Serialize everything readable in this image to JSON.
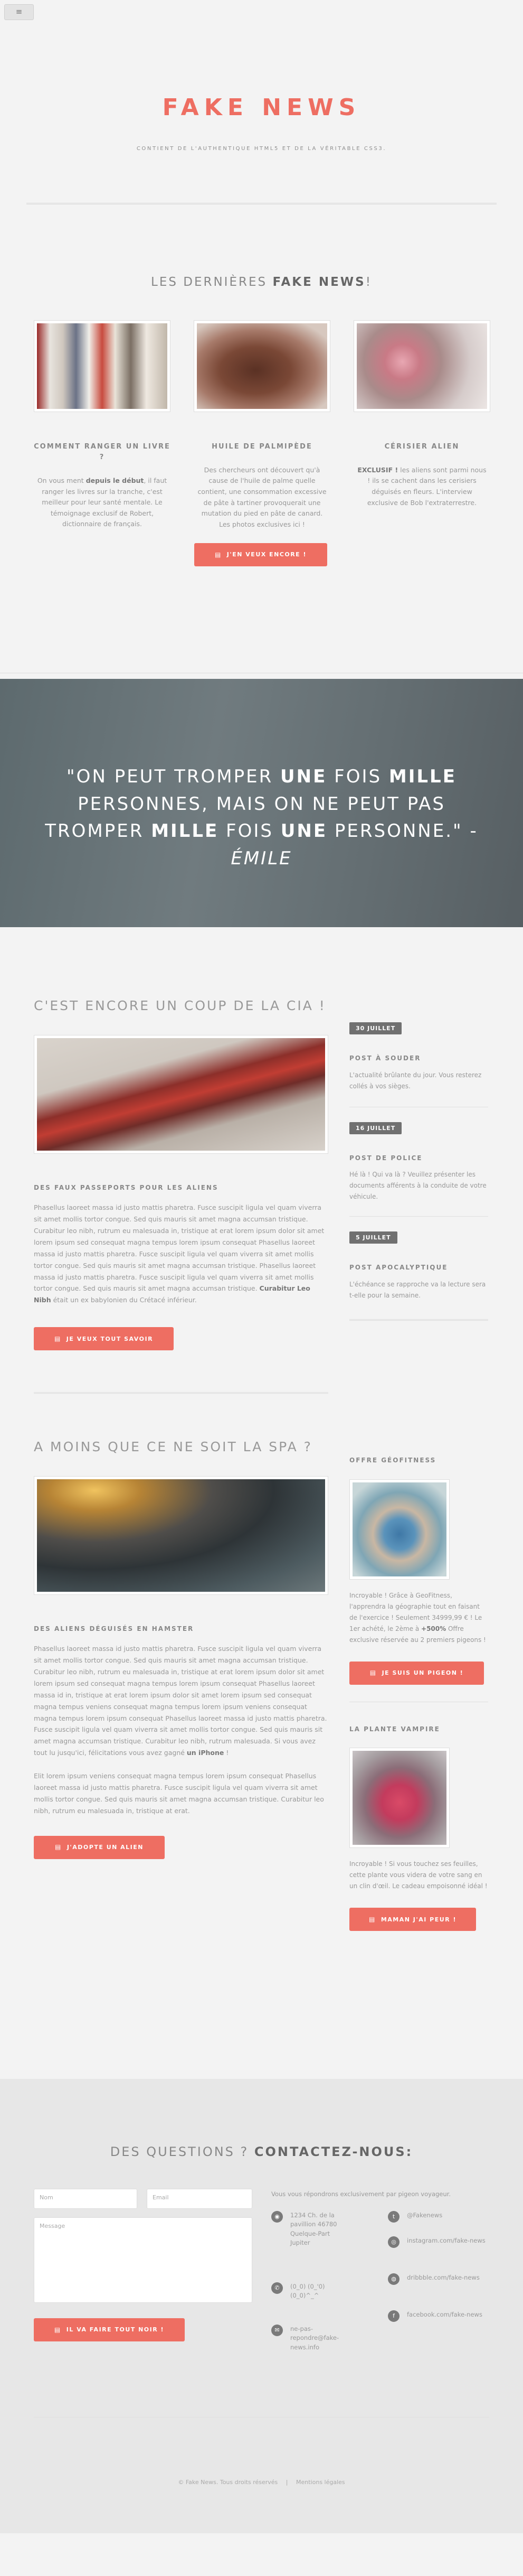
{
  "nav": {
    "menu_icon": "hamburger-icon",
    "menu_glyph": "≡"
  },
  "header": {
    "logo": "FAKE NEWS",
    "tagline": "CONTIENT DE L'AUTHENTIQUE HTML5 ET DE LA VÉRITABLE CSS3."
  },
  "recent": {
    "title_prefix": "LES DERNIÈRES ",
    "title_bold": "FAKE NEWS",
    "title_suffix": "!",
    "cards": [
      {
        "title": "COMMENT RANGER UN LIVRE ?",
        "t1": "On vous ment ",
        "b1": "depuis le début",
        "t2": ", il faut ranger les livres sur la tranche, c'est meilleur pour leur santé mentale. Le témoignage exclusif de Robert, dictionnaire de français."
      },
      {
        "title": "HUILE DE PALMIPÈDE",
        "t1": "Des chercheurs ont découvert qu'à cause de l'huile de palme quelle contient, une consommation excessive de pâte à tartiner provoquerait une mutation du pied en pâte de canard. Les photos exclusives ici !",
        "b1": "",
        "t2": ""
      },
      {
        "title": "CÉRISIER ALIEN",
        "t1": "",
        "b1": "EXCLUSIF !",
        "t2": " les aliens sont parmi nous ! ils se cachent dans les cerisiers déguisés en fleurs. L'interview exclusive de Bob l'extraterrestre."
      }
    ],
    "button": "J'EN VEUX ENCORE !"
  },
  "quote": {
    "p1": "\"ON PEUT TROMPER ",
    "b1": "UNE",
    "p2": " FOIS ",
    "b2": "MILLE",
    "p3": " PERSONNES, MAIS ON NE PEUT PAS TROMPER ",
    "b3": "MILLE",
    "p4": " FOIS ",
    "b4": "UNE",
    "p5": " PERSONNE.\" - ",
    "author": "ÉMILE"
  },
  "article1": {
    "title": "C'EST ENCORE UN COUP DE LA CIA !",
    "subtitle": "DES FAUX PASSEPORTS POUR LES ALIENS",
    "body": "Phasellus laoreet massa id justo mattis pharetra. Fusce suscipit ligula vel quam viverra sit amet mollis tortor congue. Sed quis mauris sit amet magna accumsan tristique. Curabitur leo nibh, rutrum eu malesuada in, tristique at erat lorem ipsum dolor sit amet lorem ipsum sed consequat magna tempus lorem ipsum consequat Phasellus laoreet massa id justo mattis pharetra. Fusce suscipit ligula vel quam viverra sit amet mollis tortor congue. Sed quis mauris sit amet magna accumsan tristique. Phasellus laoreet massa id justo mattis pharetra. Fusce suscipit ligula vel quam viverra sit amet mollis tortor congue. Sed quis mauris sit amet magna accumsan tristique. ",
    "bold": "Curabitur Leo Nibh",
    "tail": " était un ex babylonien du Crétacé inférieur.",
    "button": "JE VEUX TOUT SAVOIR"
  },
  "sidebar1": [
    {
      "date": "30 JUILLET",
      "title": "POST À SOUDER",
      "text": "L'actualité brûlante du jour. Vous resterez collés à vos sièges."
    },
    {
      "date": "16 JUILLET",
      "title": "POST DE POLICE",
      "text": "Hé là ! Qui va là ? Veuillez présenter les documents afférents à la conduite de votre véhicule."
    },
    {
      "date": "5 JUILLET",
      "title": "POST APOCALYPTIQUE",
      "text": "L'échéance se rapproche va la lecture sera t-elle pour la semaine."
    }
  ],
  "article2": {
    "title": "A MOINS QUE CE NE SOIT LA SPA ?",
    "subtitle": "DES ALIENS DÉGUISÉS EN HAMSTER",
    "body1": "Phasellus laoreet massa id justo mattis pharetra. Fusce suscipit ligula vel quam viverra sit amet mollis tortor congue. Sed quis mauris sit amet magna accumsan tristique. Curabitur leo nibh, rutrum eu malesuada in, tristique at erat lorem ipsum dolor sit amet lorem ipsum sed consequat magna tempus lorem ipsum consequat Phasellus laoreet massa id in, tristique at erat lorem ipsum dolor sit amet lorem ipsum sed consequat magna tempus veniens consequat magna tempus lorem ipsum veniens consequat magna tempus lorem ipsum consequat Phasellus laoreet massa id justo mattis pharetra. Fusce suscipit ligula vel quam viverra sit amet mollis tortor congue. Sed quis mauris sit amet magna accumsan tristique. Curabitur leo nibh, rutrum malesuada. Si vous avez tout lu jusqu'ici, félicitations vous avez gagné ",
    "bold1": "un iPhone",
    "tail1": " !",
    "body2": "Elit lorem ipsum veniens consequat magna tempus lorem ipsum consequat Phasellus laoreet massa id justo mattis pharetra. Fusce suscipit ligula vel quam viverra sit amet mollis tortor congue. Sed quis mauris sit amet magna accumsan tristique. Curabitur leo nibh, rutrum eu malesuada in, tristique at erat.",
    "button": "J'ADOPTE UN ALIEN"
  },
  "sidebar2": {
    "offer1": {
      "title": "OFFRE GÉOFITNESS",
      "text": "Incroyable ! Grâce à GeoFitness, l'apprendra la géographie tout en faisant de l'exercice ! Seulement 34999,99 € ! Le 1er achété, le 2ème à ",
      "bold": "+500%",
      "text2": " Offre exclusive réservée au 2 premiers pigeons !",
      "button": "JE SUIS UN PIGEON !"
    },
    "offer2": {
      "title": "LA PLANTE VAMPIRE",
      "text": "Incroyable ! Si vous touchez ses feuilles, cette plante vous videra de votre sang en un clin d'œil. Le cadeau empoisonné idéal !",
      "button": "MAMAN J'AI PEUR !"
    }
  },
  "contact": {
    "title_prefix": "DES QUESTIONS ? ",
    "title_bold": "CONTACTEZ-NOUS:",
    "name_ph": "Nom",
    "email_ph": "Email",
    "message_ph": "Message",
    "button": "IL VA FAIRE TOUT NOIR !",
    "note": "Vous vous répondrons exclusivement par pigeon voyageur.",
    "address": "1234 Ch. de la pavillion 46780 Quelque-Part Jupiter",
    "phone": "(0_0) (0_'0) (0_0)^_^",
    "email": "ne-pas-repondre@fake-news.info",
    "twitter": "@Fakenews",
    "instagram": "instagram.com/fake-news",
    "dribbble": "dribbble.com/fake-news",
    "facebook": "facebook.com/fake-news"
  },
  "footer": {
    "copy": "© Fake News. Tous droits réservés",
    "sep": "|",
    "legal": "Mentions légales"
  }
}
